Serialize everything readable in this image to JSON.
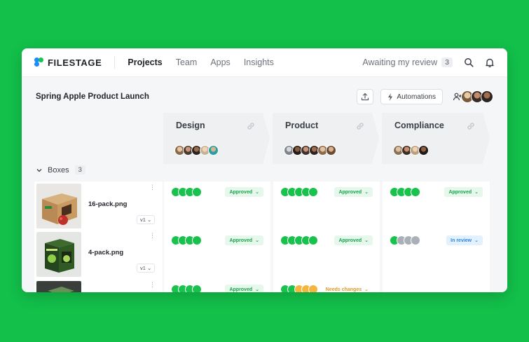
{
  "nav": {
    "logo_text": "FILESTAGE",
    "items": [
      {
        "label": "Projects",
        "active": true
      },
      {
        "label": "Team",
        "active": false
      },
      {
        "label": "Apps",
        "active": false
      },
      {
        "label": "Insights",
        "active": false
      }
    ],
    "awaiting_label": "Awaiting my review",
    "awaiting_count": "3",
    "icons": [
      "search-icon",
      "bell-icon"
    ]
  },
  "project": {
    "title": "Spring Apple Product Launch",
    "automations_label": "Automations",
    "icons": [
      "upload-icon",
      "lightning-icon",
      "add-user-icon"
    ]
  },
  "stages": [
    {
      "name": "Design"
    },
    {
      "name": "Product"
    },
    {
      "name": "Compliance"
    }
  ],
  "group": {
    "label": "Boxes",
    "count": "3"
  },
  "files": [
    {
      "name": "16-pack.png",
      "version": "v1"
    },
    {
      "name": "4-pack.png",
      "version": "v1"
    },
    {
      "name": "",
      "version": ""
    }
  ],
  "statuses": {
    "approved": "Approved",
    "in_review": "In review",
    "needs_changes": "Needs changes"
  },
  "colors": {
    "background": "#12c04a",
    "approved": "#18c24c",
    "in_review": "#2b86e0",
    "needs_changes": "#f4b43d",
    "pending": "#aab0b8"
  }
}
